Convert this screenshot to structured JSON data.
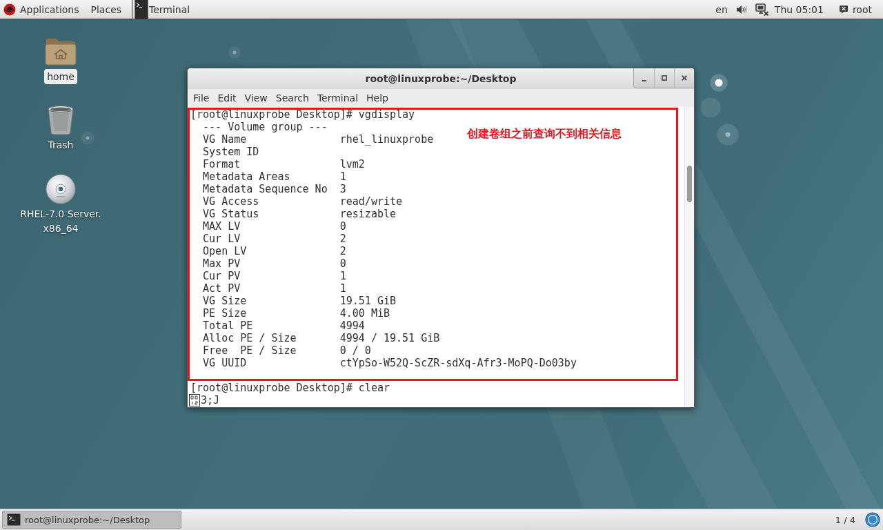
{
  "top_bar": {
    "items": [
      {
        "kind": "apps",
        "label": "Applications"
      },
      {
        "kind": "menu",
        "label": "Places"
      },
      {
        "kind": "app",
        "label": "Terminal"
      }
    ],
    "keyboard": "en",
    "clock": "Thu 05:01",
    "user": "root"
  },
  "desktop_icons": [
    {
      "kind": "folder",
      "label": "home",
      "selected": true
    },
    {
      "kind": "trash",
      "label": "Trash",
      "selected": false
    },
    {
      "kind": "disc",
      "label": "RHEL-7.0 Server. x86_64",
      "selected": false
    }
  ],
  "window": {
    "title": "root@linuxprobe:~/Desktop",
    "menu": [
      "File",
      "Edit",
      "View",
      "Search",
      "Terminal",
      "Help"
    ],
    "terminal": {
      "highlight": {
        "note": "创建卷组之前查询不到相关信息",
        "lines": [
          "[root@linuxprobe Desktop]# vgdisplay",
          "  --- Volume group ---",
          "  VG Name               rhel_linuxprobe",
          "  System ID",
          "  Format                lvm2",
          "  Metadata Areas        1",
          "  Metadata Sequence No  3",
          "  VG Access             read/write",
          "  VG Status             resizable",
          "  MAX LV                0",
          "  Cur LV                2",
          "  Open LV               2",
          "  Max PV                0",
          "  Cur PV                1",
          "  Act PV                1",
          "  VG Size               19.51 GiB",
          "  PE Size               4.00 MiB",
          "  Total PE              4994",
          "  Alloc PE / Size       4994 / 19.51 GiB",
          "  Free  PE / Size       0 / 0",
          "  VG UUID               ctYpSo-W52Q-ScZR-sdXq-Afr3-MoPQ-Do03by"
        ]
      },
      "lines": [
        {
          "kind": "text",
          "text": "[root@linuxprobe Desktop]# clear"
        },
        {
          "kind": "escape",
          "text": "3;J"
        }
      ]
    }
  },
  "taskbar": {
    "tasks": [
      {
        "title": "root@linuxprobe:~/Desktop",
        "selected": true
      }
    ],
    "workspace": "1 / 4"
  }
}
